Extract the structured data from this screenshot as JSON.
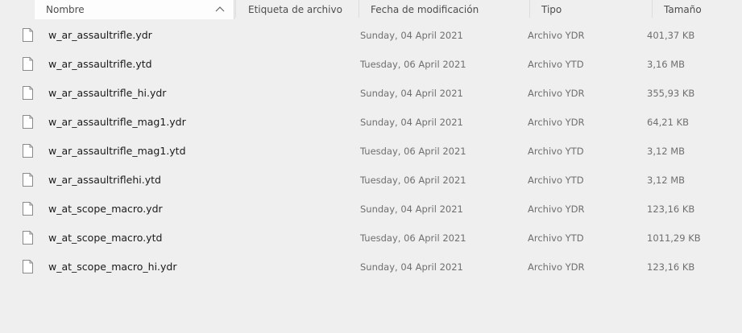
{
  "columns": {
    "name": "Nombre",
    "tag": "Etiqueta de archivo",
    "date": "Fecha de modificación",
    "type": "Tipo",
    "size": "Tamaño"
  },
  "sort": {
    "column": "name",
    "direction": "ascending",
    "icon": "chevron-up-icon"
  },
  "colors": {
    "background": "#efefef",
    "text_primary": "#1a1a1a",
    "text_secondary": "#6f6f6f"
  },
  "files": [
    {
      "name": "w_ar_assaultrifle.ydr",
      "date": "Sunday, 04 April 2021",
      "type": "Archivo YDR",
      "size": "401,37 KB"
    },
    {
      "name": "w_ar_assaultrifle.ytd",
      "date": "Tuesday, 06 April 2021",
      "type": "Archivo YTD",
      "size": "3,16 MB"
    },
    {
      "name": "w_ar_assaultrifle_hi.ydr",
      "date": "Sunday, 04 April 2021",
      "type": "Archivo YDR",
      "size": "355,93 KB"
    },
    {
      "name": "w_ar_assaultrifle_mag1.ydr",
      "date": "Sunday, 04 April 2021",
      "type": "Archivo YDR",
      "size": "64,21 KB"
    },
    {
      "name": "w_ar_assaultrifle_mag1.ytd",
      "date": "Tuesday, 06 April 2021",
      "type": "Archivo YTD",
      "size": "3,12 MB"
    },
    {
      "name": "w_ar_assaultriflehi.ytd",
      "date": "Tuesday, 06 April 2021",
      "type": "Archivo YTD",
      "size": "3,12 MB"
    },
    {
      "name": "w_at_scope_macro.ydr",
      "date": "Sunday, 04 April 2021",
      "type": "Archivo YDR",
      "size": "123,16 KB"
    },
    {
      "name": "w_at_scope_macro.ytd",
      "date": "Tuesday, 06 April 2021",
      "type": "Archivo YTD",
      "size": "1011,29 KB"
    },
    {
      "name": "w_at_scope_macro_hi.ydr",
      "date": "Sunday, 04 April 2021",
      "type": "Archivo YDR",
      "size": "123,16 KB"
    }
  ]
}
